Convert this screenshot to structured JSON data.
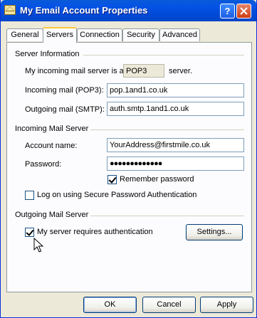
{
  "window": {
    "title": "My Email Account Properties",
    "help_label": "?",
    "close_label": "X"
  },
  "tabs": [
    {
      "label": "General"
    },
    {
      "label": "Servers"
    },
    {
      "label": "Connection"
    },
    {
      "label": "Security"
    },
    {
      "label": "Advanced"
    }
  ],
  "server_info": {
    "group_label": "Server Information",
    "prefix_text": "My incoming mail server is a",
    "server_type": "POP3",
    "suffix_text": "server.",
    "incoming_label": "Incoming mail (POP3):",
    "incoming_value": "pop.1and1.co.uk",
    "outgoing_label": "Outgoing mail (SMTP):",
    "outgoing_value": "auth.smtp.1and1.co.uk"
  },
  "incoming_server": {
    "group_label": "Incoming Mail Server",
    "account_label": "Account name:",
    "account_value": "YourAddress@firstmile.co.uk",
    "password_label": "Password:",
    "password_value": "●●●●●●●●●●●●●",
    "remember_label": "Remember password",
    "remember_checked": true,
    "spa_label": "Log on using Secure Password Authentication",
    "spa_checked": false
  },
  "outgoing_server": {
    "group_label": "Outgoing Mail Server",
    "auth_label": "My server requires authentication",
    "auth_checked": true,
    "settings_label": "Settings..."
  },
  "buttons": {
    "ok": "OK",
    "cancel": "Cancel",
    "apply": "Apply"
  }
}
